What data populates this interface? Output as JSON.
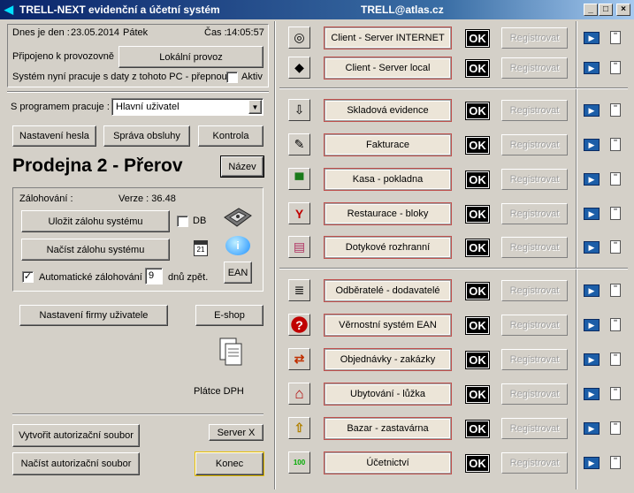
{
  "window": {
    "title": "TRELL-NEXT evidenční a účetní systém",
    "email": "TRELL@atlas.cz",
    "min": "_",
    "max": "□",
    "close": "×"
  },
  "info": {
    "date_label": "Dnes je den :",
    "date_value": "23.05.2014",
    "day": "Pátek",
    "time_label": "Čas :",
    "time_value": "14:05:57",
    "connected_label": "Připojeno k provozovně",
    "local_button": "Lokální provoz",
    "switch_text": "Systém nyní pracuje s daty z tohoto PC - přepnout",
    "active_label": "Aktiv"
  },
  "program": {
    "label": "S programem pracuje :",
    "selected": "Hlavní uživatel"
  },
  "buttons": {
    "password": "Nastavení hesla",
    "staff": "Správa obsluhy",
    "check": "Kontrola",
    "name": "Název",
    "company": "Nastavení  firmy  uživatele",
    "eshop": "E-shop",
    "create_auth": "Vytvořit autorizační soubor",
    "load_auth": "Načíst autorizační soubor",
    "serverx": "Server X",
    "end": "Konec"
  },
  "store_name": "Prodejna 2 - Přerov",
  "backup": {
    "label": "Zálohování :",
    "version": "Verze : 36.48",
    "save": "Uložit zálohu systému",
    "load": "Načíst zálohu systému",
    "db_label": "DB",
    "auto_label": "Automatické zálohování",
    "days_value": "9",
    "days_suffix": "dnů zpět.",
    "ean": "EAN",
    "calendar_day": "21"
  },
  "vat": "Plátce DPH",
  "modules": [
    {
      "label": "Client - Server INTERNET",
      "icon": "globe-icon",
      "glyph": "◎"
    },
    {
      "label": "Client - Server local",
      "icon": "network-icon",
      "glyph": "◆"
    },
    {
      "label": "Skladová evidence",
      "icon": "arrow-down-icon",
      "glyph": "⇩"
    },
    {
      "label": "Fakturace",
      "icon": "invoice-icon",
      "glyph": "✎"
    },
    {
      "label": "Kasa - pokladna",
      "icon": "cash-register-icon",
      "glyph": "▀"
    },
    {
      "label": "Restaurace - bloky",
      "icon": "glass-icon",
      "glyph": "Y"
    },
    {
      "label": "Dotykové rozhranní",
      "icon": "touch-screen-icon",
      "glyph": "▤"
    },
    {
      "label": "Odběratelé - dodavatelé",
      "icon": "list-icon",
      "glyph": "≣"
    },
    {
      "label": "Věrnostní systém EAN",
      "icon": "question-icon",
      "glyph": "?"
    },
    {
      "label": "Objednávky - zakázky",
      "icon": "exchange-icon",
      "glyph": "⇄"
    },
    {
      "label": "Ubytování - lůžka",
      "icon": "house-icon",
      "glyph": "⌂"
    },
    {
      "label": "Bazar - zastavárna",
      "icon": "upload-icon",
      "glyph": "⇧"
    },
    {
      "label": "Účetnictví",
      "icon": "accounting-icon",
      "glyph": "100"
    }
  ],
  "ok_label": "OK",
  "register_label": "Registrovat",
  "colors": {
    "title_start": "#0a246a",
    "title_end": "#a6caf0",
    "module_border": "#c0504d",
    "ok_bg": "#000000"
  }
}
